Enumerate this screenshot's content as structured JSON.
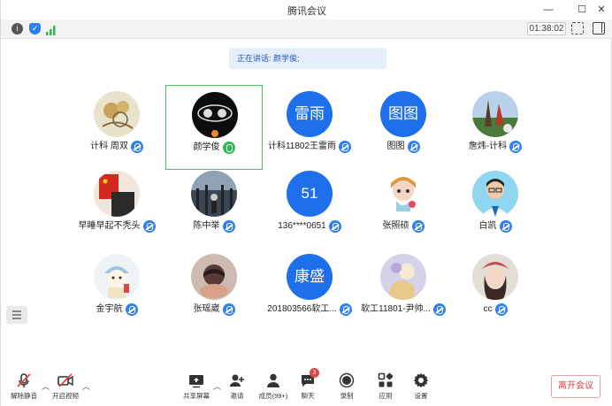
{
  "window": {
    "title": "腾讯会议",
    "minimize_icon": "minimize-icon",
    "maximize_icon": "maximize-icon",
    "close_icon": "close-icon"
  },
  "infobar": {
    "timer": "01:38:02",
    "icons": [
      "info-icon",
      "shield-icon",
      "signal-icon",
      "fullscreen-icon",
      "sidebar-toggle-icon"
    ]
  },
  "speaking": {
    "label": "正在讲话: 颜学俊;"
  },
  "participants": [
    {
      "name": "计科 周双",
      "mic": "muted"
    },
    {
      "name": "颜学俊",
      "mic": "speaking"
    },
    {
      "name": "计科11802王雷雨",
      "avatar_text": "雷雨",
      "mic": "muted"
    },
    {
      "name": "图图",
      "avatar_text": "图图",
      "mic": "muted"
    },
    {
      "name": "詹炜-计科",
      "mic": "muted"
    },
    {
      "name": "早睡早起不秃头",
      "mic": "muted"
    },
    {
      "name": "陈中举",
      "mic": "muted"
    },
    {
      "name": "136****0651",
      "avatar_text": "51",
      "mic": "muted"
    },
    {
      "name": "张照硕",
      "mic": "muted"
    },
    {
      "name": "白凯",
      "mic": "muted"
    },
    {
      "name": "金宇航",
      "mic": "muted"
    },
    {
      "name": "张瑶崴",
      "mic": "muted"
    },
    {
      "name": "201803566软工...",
      "avatar_text": "康盛",
      "mic": "muted"
    },
    {
      "name": "软工11801-尹帅...",
      "mic": "muted"
    },
    {
      "name": "cc",
      "mic": "muted"
    }
  ],
  "toolbar": {
    "unmute": "解除静音",
    "start_video": "开启视频",
    "share_screen": "共享屏幕",
    "invite": "邀请",
    "members": "成员(99+)",
    "chat": "聊天",
    "chat_badge": "3",
    "record": "录制",
    "apps": "应用",
    "settings": "设置",
    "leave": "离开会议"
  },
  "colors": {
    "accent": "#1e6fec",
    "speaking_border": "#4fc16b",
    "leave_text": "#e0413b"
  }
}
